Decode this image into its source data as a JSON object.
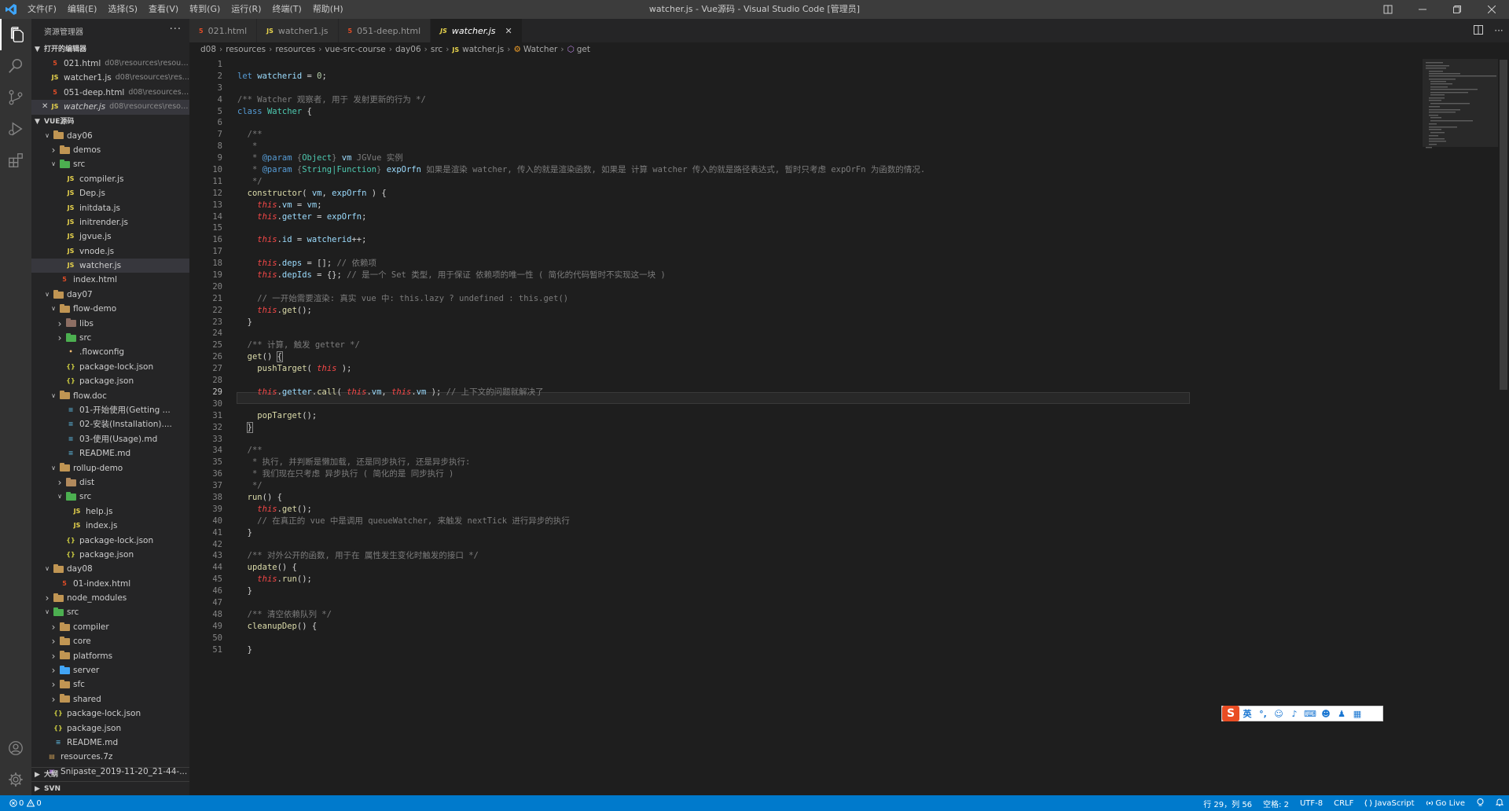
{
  "window": {
    "title": "watcher.js - Vue源码 - Visual Studio Code [管理员]",
    "menus": [
      "文件(F)",
      "编辑(E)",
      "选择(S)",
      "查看(V)",
      "转到(G)",
      "运行(R)",
      "终端(T)",
      "帮助(H)"
    ]
  },
  "sidebar": {
    "header": "资源管理器",
    "open_editors_title": "打开的编辑器",
    "open_editors": [
      {
        "name": "021.html",
        "path": "d08\\resources\\resour...",
        "type": "html"
      },
      {
        "name": "watcher1.js",
        "path": "d08\\resources\\res...",
        "type": "js"
      },
      {
        "name": "051-deep.html",
        "path": "d08\\resources\\...",
        "type": "html"
      },
      {
        "name": "watcher.js",
        "path": "d08\\resources\\resou...",
        "type": "js"
      }
    ],
    "workspace_title": "VUE源码",
    "tree": [
      {
        "label": "day06",
        "depth": 2,
        "kind": "folder",
        "open": true
      },
      {
        "label": "demos",
        "depth": 3,
        "kind": "folder",
        "open": false
      },
      {
        "label": "src",
        "depth": 3,
        "kind": "src",
        "open": true
      },
      {
        "label": "compiler.js",
        "depth": 4,
        "kind": "js"
      },
      {
        "label": "Dep.js",
        "depth": 4,
        "kind": "js"
      },
      {
        "label": "initdata.js",
        "depth": 4,
        "kind": "js"
      },
      {
        "label": "initrender.js",
        "depth": 4,
        "kind": "js"
      },
      {
        "label": "jgvue.js",
        "depth": 4,
        "kind": "js"
      },
      {
        "label": "vnode.js",
        "depth": 4,
        "kind": "js"
      },
      {
        "label": "watcher.js",
        "depth": 4,
        "kind": "js",
        "selected": true
      },
      {
        "label": "index.html",
        "depth": 3,
        "kind": "html"
      },
      {
        "label": "day07",
        "depth": 2,
        "kind": "folder",
        "open": true
      },
      {
        "label": "flow-demo",
        "depth": 3,
        "kind": "folder",
        "open": true
      },
      {
        "label": "libs",
        "depth": 4,
        "kind": "lib",
        "open": false
      },
      {
        "label": "src",
        "depth": 4,
        "kind": "src",
        "open": false
      },
      {
        "label": ".flowconfig",
        "depth": 4,
        "kind": "cfg"
      },
      {
        "label": "package-lock.json",
        "depth": 4,
        "kind": "json"
      },
      {
        "label": "package.json",
        "depth": 4,
        "kind": "json"
      },
      {
        "label": "flow.doc",
        "depth": 3,
        "kind": "folder",
        "open": true
      },
      {
        "label": "01-开始使用(Getting ...",
        "depth": 4,
        "kind": "md"
      },
      {
        "label": "02-安装(Installation)....",
        "depth": 4,
        "kind": "md"
      },
      {
        "label": "03-使用(Usage).md",
        "depth": 4,
        "kind": "md"
      },
      {
        "label": "README.md",
        "depth": 4,
        "kind": "md"
      },
      {
        "label": "rollup-demo",
        "depth": 3,
        "kind": "folder",
        "open": true
      },
      {
        "label": "dist",
        "depth": 4,
        "kind": "dist",
        "open": false
      },
      {
        "label": "src",
        "depth": 4,
        "kind": "src",
        "open": true
      },
      {
        "label": "help.js",
        "depth": 5,
        "kind": "js"
      },
      {
        "label": "index.js",
        "depth": 5,
        "kind": "js"
      },
      {
        "label": "package-lock.json",
        "depth": 4,
        "kind": "json"
      },
      {
        "label": "package.json",
        "depth": 4,
        "kind": "json"
      },
      {
        "label": "day08",
        "depth": 2,
        "kind": "folder",
        "open": true
      },
      {
        "label": "01-index.html",
        "depth": 3,
        "kind": "html"
      },
      {
        "label": "node_modules",
        "depth": 2,
        "kind": "folder",
        "open": false
      },
      {
        "label": "src",
        "depth": 2,
        "kind": "src",
        "open": true
      },
      {
        "label": "compiler",
        "depth": 3,
        "kind": "folder",
        "open": false
      },
      {
        "label": "core",
        "depth": 3,
        "kind": "folder",
        "open": false
      },
      {
        "label": "platforms",
        "depth": 3,
        "kind": "folder",
        "open": false
      },
      {
        "label": "server",
        "depth": 3,
        "kind": "srv",
        "open": false
      },
      {
        "label": "sfc",
        "depth": 3,
        "kind": "folder",
        "open": false
      },
      {
        "label": "shared",
        "depth": 3,
        "kind": "folder",
        "open": false
      },
      {
        "label": "package-lock.json",
        "depth": 2,
        "kind": "json"
      },
      {
        "label": "package.json",
        "depth": 2,
        "kind": "json"
      },
      {
        "label": "README.md",
        "depth": 2,
        "kind": "md"
      },
      {
        "label": "resources.7z",
        "depth": 1,
        "kind": "zip"
      },
      {
        "label": "Snipaste_2019-11-20_21-44-...",
        "depth": 1,
        "kind": "img"
      }
    ],
    "outline_title": "大纲",
    "svn_title": "SVN"
  },
  "tabs": [
    {
      "label": "021.html",
      "type": "html",
      "active": false
    },
    {
      "label": "watcher1.js",
      "type": "js",
      "active": false
    },
    {
      "label": "051-deep.html",
      "type": "html",
      "active": false
    },
    {
      "label": "watcher.js",
      "type": "js",
      "active": true
    }
  ],
  "breadcrumb": [
    "d08",
    "resources",
    "resources",
    "vue-src-course",
    "day06",
    "src",
    "watcher.js",
    "Watcher",
    "get"
  ],
  "editor": {
    "current_line": 29,
    "first_line": 1,
    "line_count": 51
  },
  "ime": {
    "logo": "S",
    "lang": "英"
  },
  "statusbar": {
    "errors": "0",
    "warnings": "0",
    "position": "行 29，列 56",
    "indent": "空格: 2",
    "encoding": "UTF-8",
    "eol": "CRLF",
    "language": "JavaScript",
    "golive": "Go Live"
  },
  "colors": {
    "statusbar": "#007acc",
    "titlebar": "#3c3c3c",
    "activitybar": "#333333",
    "sidebar": "#252526",
    "editor": "#1e1e1e"
  }
}
